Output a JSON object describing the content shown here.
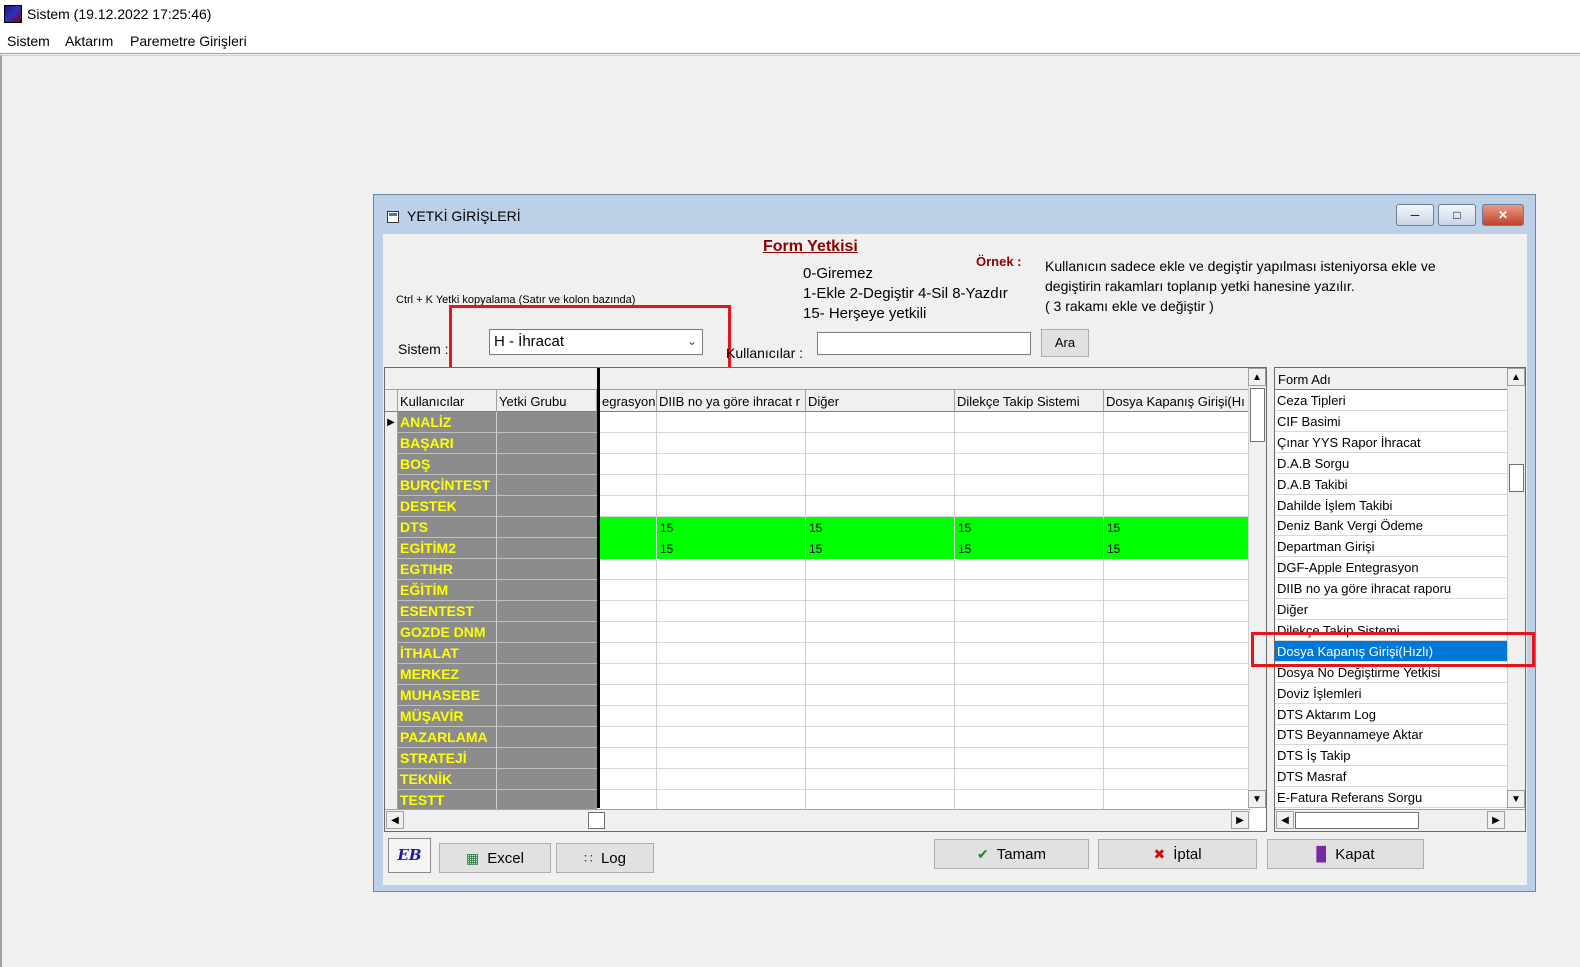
{
  "window": {
    "title": "Sistem (19.12.2022 17:25:46)"
  },
  "menu": [
    "Sistem",
    "Aktarım",
    "Paremetre Girişleri"
  ],
  "dialog": {
    "title": "YETKİ GİRİŞLERİ",
    "form_title": "Form Yetkisi",
    "codes": [
      "0-Giremez",
      "1-Ekle  2-Degiştir  4-Sil  8-Yazdır",
      "15- Herşeye yetkili"
    ],
    "ornek_label": "Örnek :",
    "explanation": [
      "Kullanıcın sadece ekle ve degiştir yapılması isteniyorsa  ekle ve",
      "degiştirin rakamları toplanıp yetki hanesine yazılır.",
      " ( 3 rakamı ekle ve değiştir )"
    ],
    "ctrl_hint": "Ctrl + K Yetki kopyalama (Satır ve kolon bazında)",
    "sistem_label": "Sistem :",
    "sistem_value": "H - İhracat",
    "kullanicilar_label": "Kullanıcılar :",
    "kullanicilar_value": "",
    "ara_button": "Ara"
  },
  "grid": {
    "columns": [
      "Kullanıcılar",
      "Yetki Grubu",
      "egrasyon",
      "DIIB no ya göre ihracat r",
      "Diğer",
      "Dilekçe Takip Sistemi",
      "Dosya Kapanış Girişi(Hı"
    ],
    "rows": [
      {
        "user": "ANALİZ",
        "values": [
          "",
          "",
          "",
          "",
          ""
        ]
      },
      {
        "user": "BAŞARI",
        "values": [
          "",
          "",
          "",
          "",
          ""
        ]
      },
      {
        "user": "BOŞ",
        "values": [
          "",
          "",
          "",
          "",
          ""
        ]
      },
      {
        "user": "BURÇİNTEST",
        "values": [
          "",
          "",
          "",
          "",
          ""
        ]
      },
      {
        "user": "DESTEK",
        "values": [
          "",
          "",
          "",
          "",
          ""
        ]
      },
      {
        "user": "DTS",
        "values": [
          "",
          "15",
          "15",
          "15",
          "15"
        ]
      },
      {
        "user": "EGİTİM2",
        "values": [
          "",
          "15",
          "15",
          "15",
          "15"
        ]
      },
      {
        "user": "EGTIHR",
        "values": [
          "",
          "",
          "",
          "",
          ""
        ]
      },
      {
        "user": "EĞİTİM",
        "values": [
          "",
          "",
          "",
          "",
          ""
        ]
      },
      {
        "user": "ESENTEST",
        "values": [
          "",
          "",
          "",
          "",
          ""
        ]
      },
      {
        "user": "GOZDE DNM",
        "values": [
          "",
          "",
          "",
          "",
          ""
        ]
      },
      {
        "user": "İTHALAT",
        "values": [
          "",
          "",
          "",
          "",
          ""
        ]
      },
      {
        "user": "MERKEZ",
        "values": [
          "",
          "",
          "",
          "",
          ""
        ]
      },
      {
        "user": "MUHASEBE",
        "values": [
          "",
          "",
          "",
          "",
          ""
        ]
      },
      {
        "user": "MÜŞAVİR",
        "values": [
          "",
          "",
          "",
          "",
          ""
        ]
      },
      {
        "user": "PAZARLAMA",
        "values": [
          "",
          "",
          "",
          "",
          ""
        ]
      },
      {
        "user": "STRATEJİ",
        "values": [
          "",
          "",
          "",
          "",
          ""
        ]
      },
      {
        "user": "TEKNİK",
        "values": [
          "",
          "",
          "",
          "",
          ""
        ]
      },
      {
        "user": "TESTT",
        "values": [
          "",
          "",
          "",
          "",
          ""
        ]
      }
    ],
    "highlight_color": "#00ff00",
    "user_text_color": "#ffff00"
  },
  "form_list": {
    "header": "Form Adı",
    "items": [
      "Ceza Tipleri",
      "CIF Basimi",
      "Çınar YYS Rapor İhracat",
      "D.A.B Sorgu",
      "D.A.B Takibi",
      "Dahilde İşlem Takibi",
      "Deniz Bank Vergi Ödeme",
      "Departman Girişi",
      "DGF-Apple Entegrasyon",
      "DIIB no ya göre ihracat raporu",
      "Diğer",
      "Dilekçe Takip Sistemi",
      "Dosya Kapanış Girişi(Hızlı)",
      "Dosya No Değiştirme Yetkisi",
      "Doviz İşlemleri",
      "DTS Aktarım Log",
      "DTS Beyannameye Aktar",
      "DTS İş Takip",
      "DTS Masraf",
      "E-Fatura Referans Sorgu"
    ],
    "selected": "Dosya Kapanış Girişi(Hızlı)"
  },
  "buttons": {
    "eb": "EB",
    "excel": "Excel",
    "log": "Log",
    "tamam": "Tamam",
    "iptal": "İptal",
    "kapat": "Kapat"
  }
}
